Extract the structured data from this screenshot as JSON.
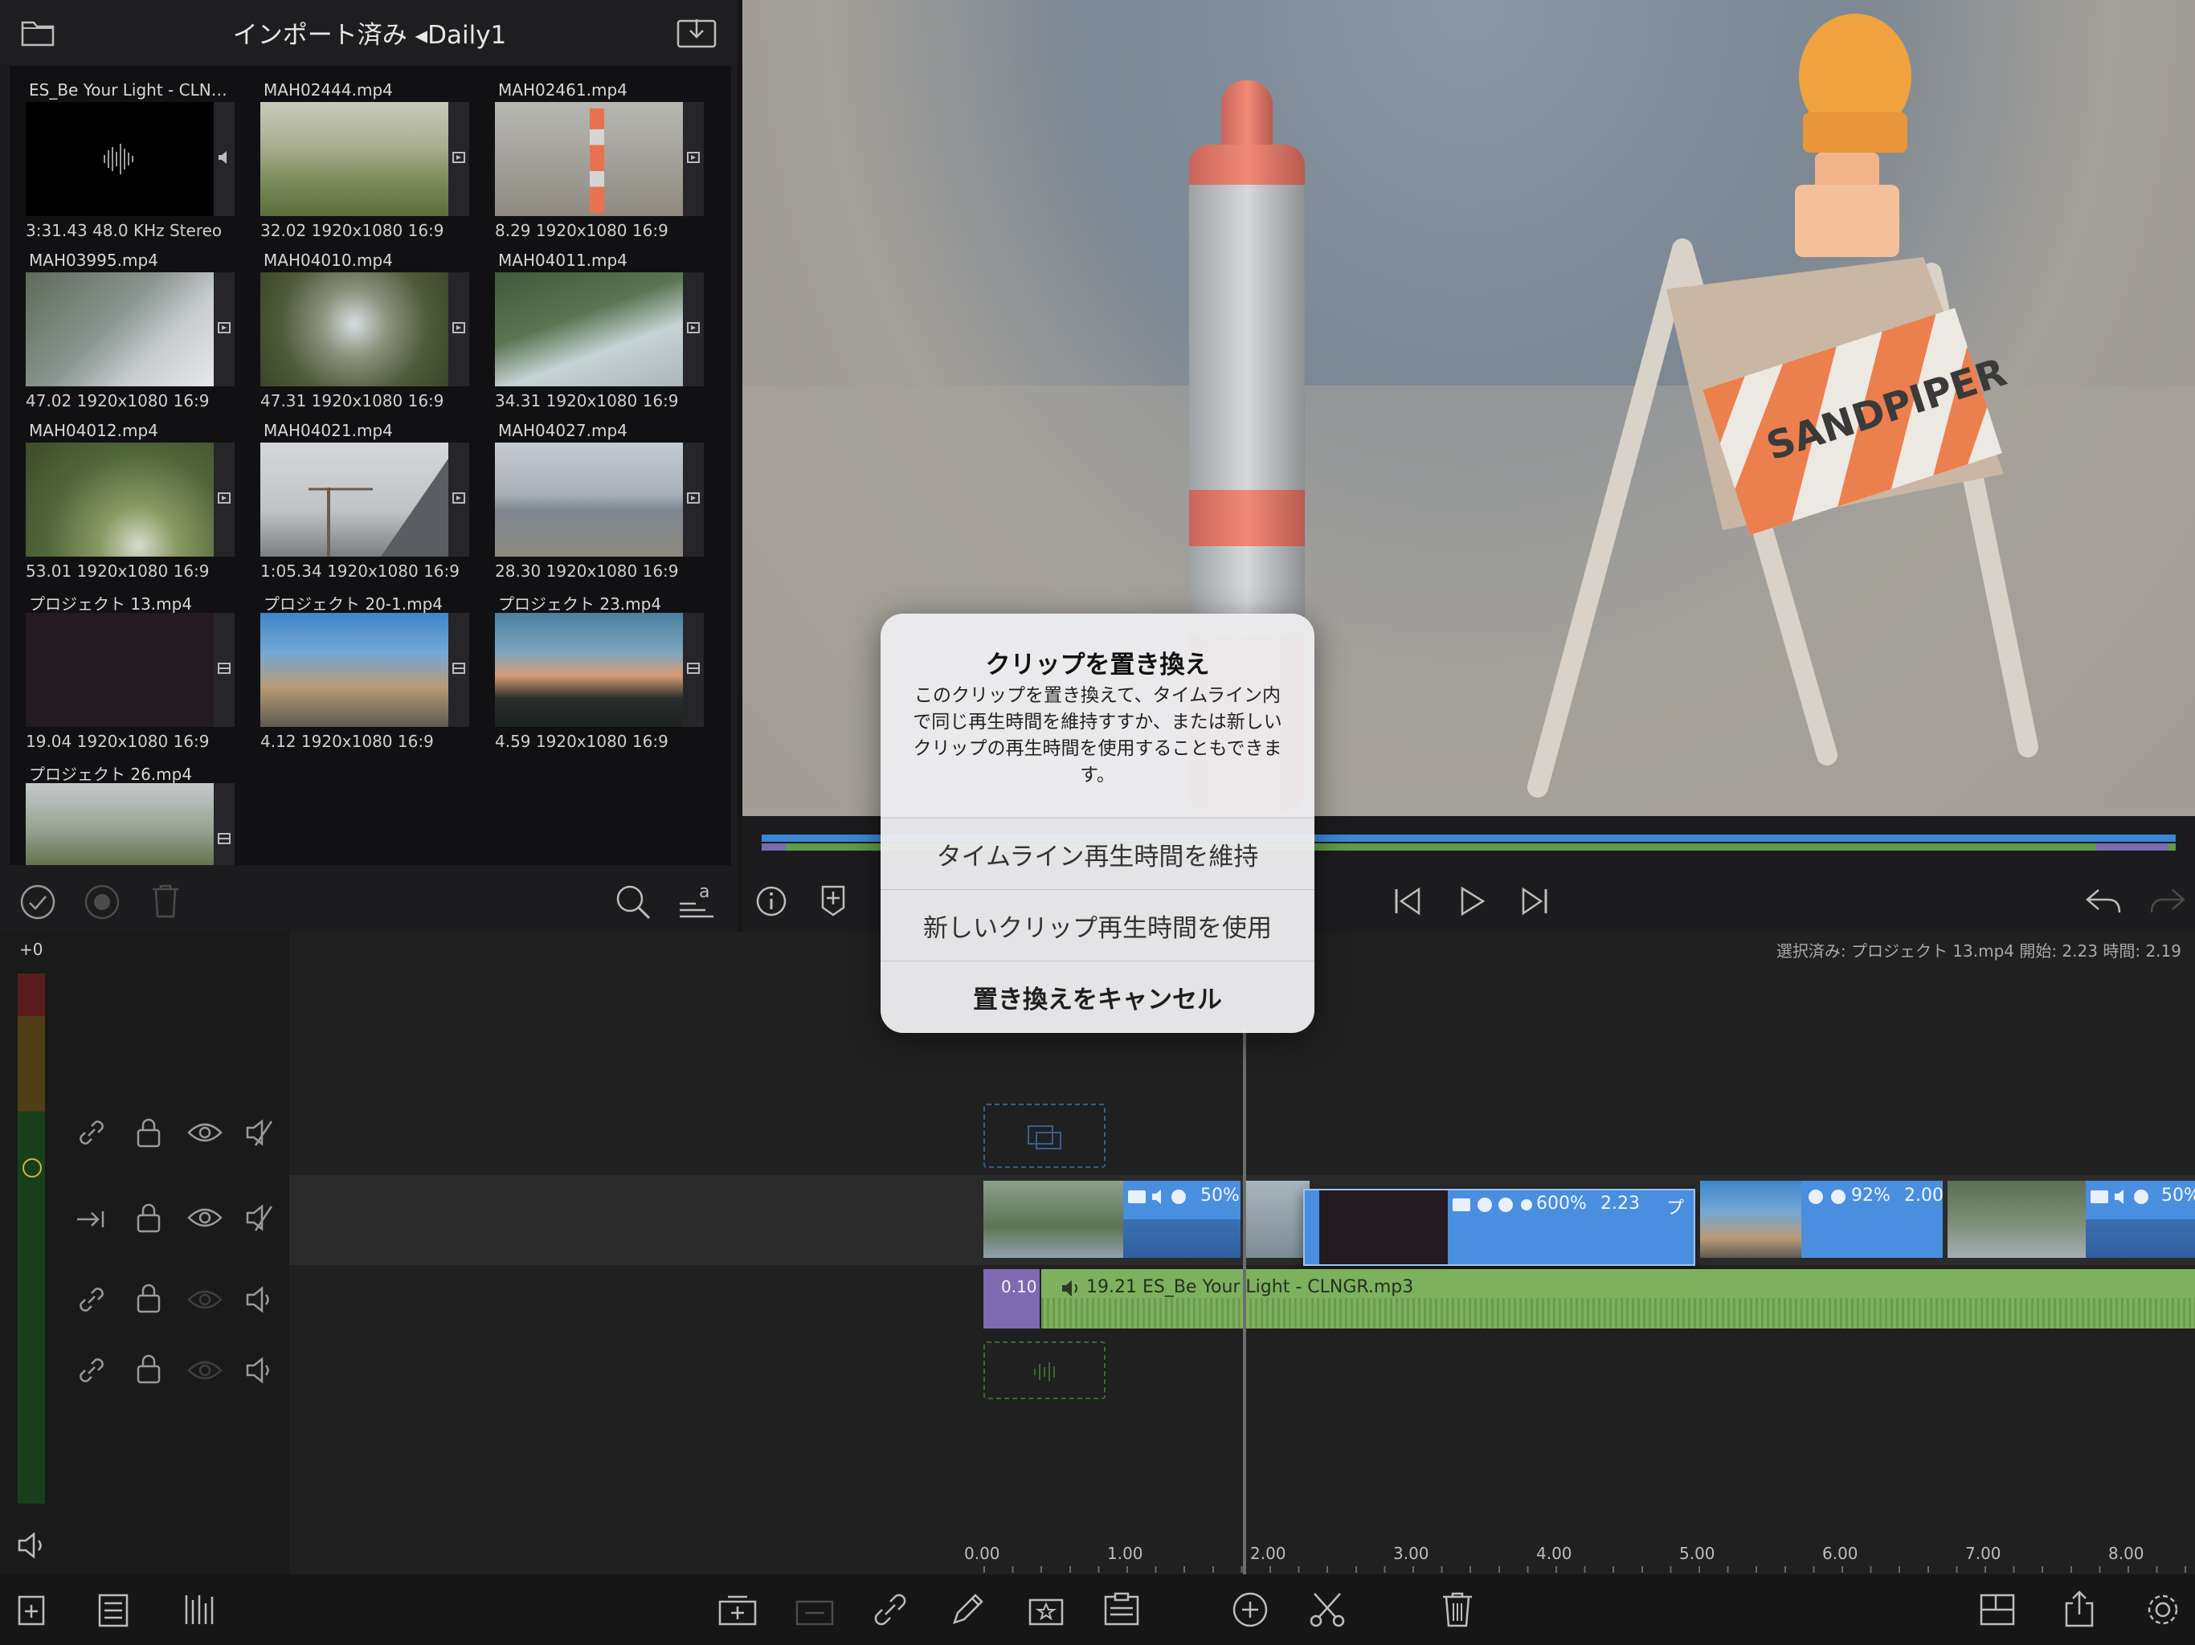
{
  "browser": {
    "title": "インポート済み ◂Daily1",
    "clips": [
      {
        "name": "ES_Be Your Light - CLNG...",
        "info": "3:31.43  48.0 KHz  Stereo",
        "kind": "audio"
      },
      {
        "name": "MAH02444.mp4",
        "info": "32.02  1920x1080  16:9",
        "kind": "video"
      },
      {
        "name": "MAH02461.mp4",
        "info": "8.29  1920x1080  16:9",
        "kind": "video"
      },
      {
        "name": "MAH03995.mp4",
        "info": "47.02  1920x1080  16:9",
        "kind": "video"
      },
      {
        "name": "MAH04010.mp4",
        "info": "47.31  1920x1080  16:9",
        "kind": "video"
      },
      {
        "name": "MAH04011.mp4",
        "info": "34.31  1920x1080  16:9",
        "kind": "video"
      },
      {
        "name": "MAH04012.mp4",
        "info": "53.01  1920x1080  16:9",
        "kind": "video"
      },
      {
        "name": "MAH04021.mp4",
        "info": "1:05.34  1920x1080  16:9",
        "kind": "video"
      },
      {
        "name": "MAH04027.mp4",
        "info": "28.30  1920x1080  16:9",
        "kind": "video"
      },
      {
        "name": "プロジェクト 13.mp4",
        "info": "19.04  1920x1080  16:9",
        "kind": "project"
      },
      {
        "name": "プロジェクト 20-1.mp4",
        "info": "4.12  1920x1080  16:9",
        "kind": "project"
      },
      {
        "name": "プロジェクト 23.mp4",
        "info": "4.59  1920x1080  16:9",
        "kind": "project"
      },
      {
        "name": "プロジェクト 26.mp4",
        "info": "",
        "kind": "project"
      }
    ]
  },
  "viewer": {
    "sign_text": "SANDPIPER"
  },
  "timeline": {
    "level": "+0",
    "selection_info": "選択済み: プロジェクト 13.mp4 開始: 2.23 時間: 2.19",
    "ruler": [
      "0.00",
      "1.00",
      "2.00",
      "3.00",
      "4.00",
      "5.00",
      "6.00",
      "7.00",
      "8.00"
    ],
    "clips": {
      "clip1_speed": "50%",
      "clip2_speed": "600%",
      "clip2_duration": "2.23",
      "clip2_trail": "プ",
      "clip3_speed": "92%",
      "clip3_duration": "2.00",
      "clip4_speed": "50%",
      "audio_fade": "0.10",
      "audio_label": "19.21  ES_Be Your Light - CLNGR.mp3"
    }
  },
  "dialog": {
    "title": "クリップを置き換え",
    "message": "このクリップを置き換えて、タイムライン内で同じ再生時間を維持すすか、または新しいクリップの再生時間を使用することもできます。",
    "btn_keep": "タイムライン再生時間を維持",
    "btn_new": "新しいクリップ再生時間を使用",
    "btn_cancel": "置き換えをキャンセル"
  },
  "colors": {
    "video_clip": "#4a8ee0",
    "audio_clip": "#7eb15e",
    "fade": "#7d6ab1",
    "meter_green": "#1d5a1d"
  }
}
